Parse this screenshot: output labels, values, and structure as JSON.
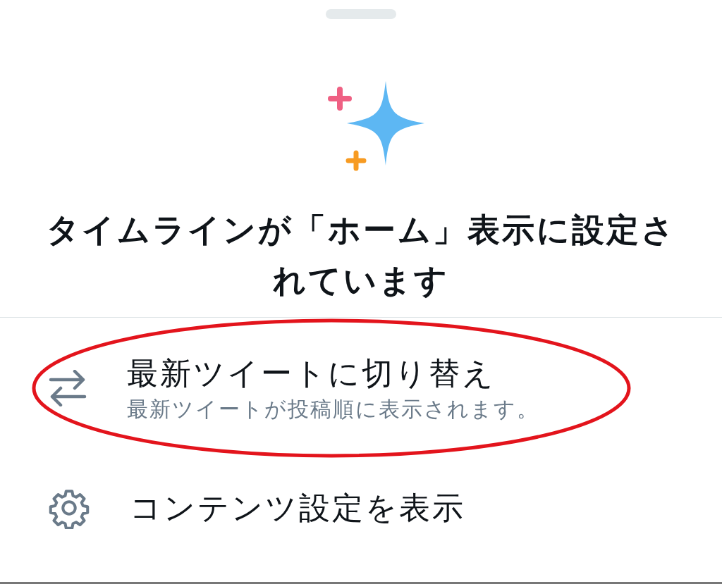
{
  "sheet": {
    "title": "タイムラインが「ホーム」表示に設定されています"
  },
  "menu": [
    {
      "kind": "switch",
      "label": "最新ツイートに切り替え",
      "description": "最新ツイートが投稿順に表示されます。",
      "highlighted": true
    },
    {
      "kind": "settings",
      "label": "コンテンツ設定を表示",
      "highlighted": false
    }
  ]
}
